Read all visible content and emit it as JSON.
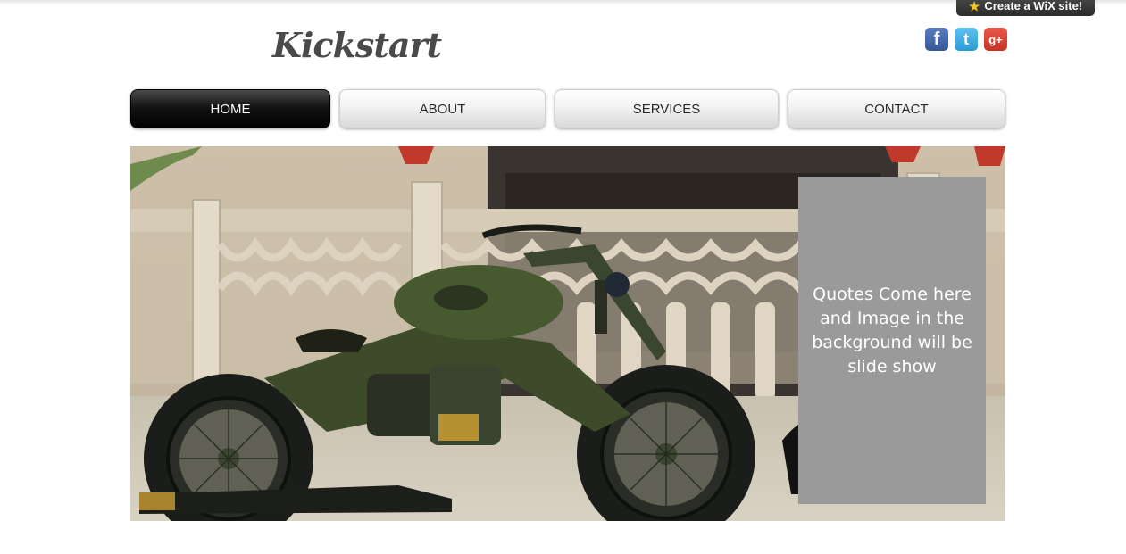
{
  "wix_badge": {
    "label": "Create a WiX site!",
    "icon": "star-icon"
  },
  "site": {
    "logo": "Kickstart"
  },
  "social": [
    {
      "name": "facebook",
      "glyph": "f"
    },
    {
      "name": "twitter",
      "glyph": "t"
    },
    {
      "name": "google-plus",
      "glyph": "g+"
    }
  ],
  "nav": [
    {
      "label": "HOME",
      "active": true
    },
    {
      "label": "ABOUT",
      "active": false
    },
    {
      "label": "SERVICES",
      "active": false
    },
    {
      "label": "CONTACT",
      "active": false
    }
  ],
  "hero": {
    "image": "green vintage motorcycle parked in front of stone balustrade",
    "quote": "Quotes Come here and Image in the background will be slide show"
  },
  "colors": {
    "nav_active": "#000000",
    "quote_box": "#9a9a9a",
    "logo": "#4a4a4a"
  }
}
